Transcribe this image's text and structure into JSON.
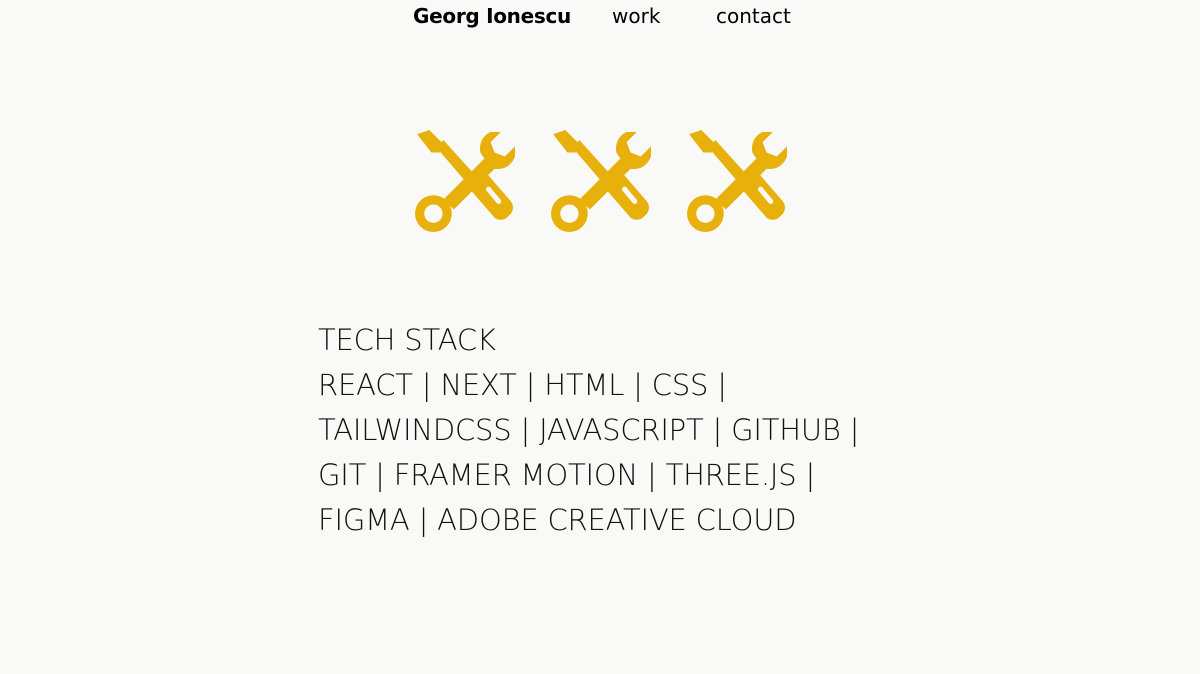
{
  "nav": {
    "brand": "Georg Ionescu",
    "work": "work",
    "contact": "contact"
  },
  "hero": {
    "icons": [
      "tools-icon",
      "tools-icon",
      "tools-icon"
    ],
    "icon_color": "#e8b00a"
  },
  "tech_stack": {
    "title": "TECH STACK",
    "list": "REACT | NEXT | HTML | CSS | TAILWINDCSS | JAVASCRIPT | GITHUB | GIT | FRAMER MOTION | THREE.JS | FIGMA | ADOBE CREATIVE CLOUD"
  },
  "colors": {
    "background": "#f9f9f7",
    "text": "#111111",
    "accent": "#e8b00a"
  }
}
